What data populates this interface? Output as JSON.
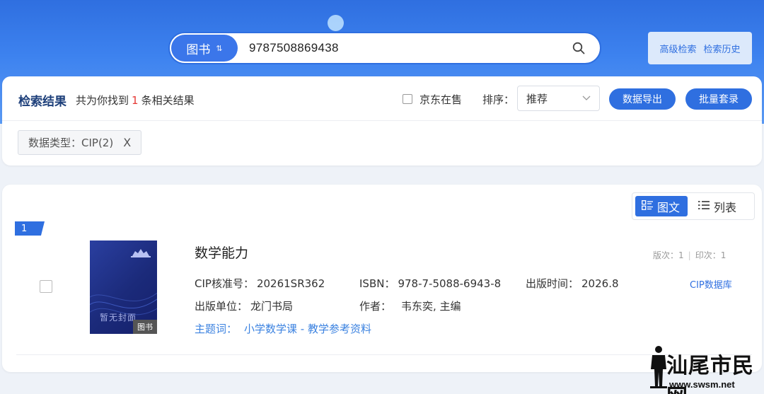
{
  "search": {
    "type_label": "图书",
    "type_toggle_glyph": "⇅",
    "query": "9787508869438"
  },
  "header_links": {
    "advanced": "高级检索",
    "history": "检索历史"
  },
  "results": {
    "title": "检索结果",
    "count_prefix": "共为你找到",
    "count": "1",
    "count_suffix": "条相关结果",
    "jd_label": "京东在售",
    "sort_label": "排序：",
    "sort_value": "推荐",
    "export_label": "数据导出",
    "batch_label": "批量套录",
    "filter_tag": "数据类型：CIP(2)",
    "filter_close": "X"
  },
  "view": {
    "grid_label": "图文",
    "list_label": "列表"
  },
  "item": {
    "rank": "1",
    "cover_placeholder": "暂无封面",
    "cover_badge": "图书",
    "title": "数学能力",
    "edition_label": "版次：",
    "edition": "1",
    "print_label": "印次：",
    "print": "1",
    "cip_label": "CIP核准号：",
    "cip": "20261SR362",
    "isbn_label": "ISBN：",
    "isbn": "978-7-5088-6943-8",
    "pubdate_label": "出版时间：",
    "pubdate": "2026.8",
    "publisher_label": "出版单位：",
    "publisher": "龙门书局",
    "author_label": "作者：",
    "author": "韦东奕, 主编",
    "db_link": "CIP数据库",
    "subject_label": "主题词：",
    "subject": "小学数学课 - 教学参考资料"
  },
  "watermark": {
    "name": "汕尾市民网",
    "url": "www.swsm.net"
  },
  "colors": {
    "primary": "#2f6fe0",
    "count_red": "#e53935"
  }
}
